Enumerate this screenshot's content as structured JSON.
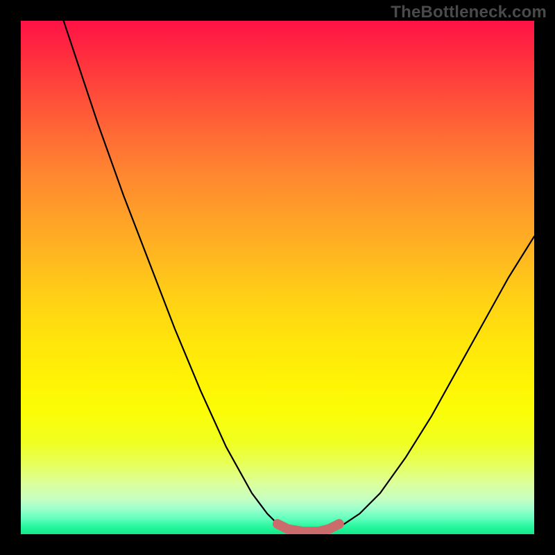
{
  "watermark": "TheBottleneck.com",
  "chart_data": {
    "type": "line",
    "title": "",
    "xlabel": "",
    "ylabel": "",
    "xlim": [
      0,
      100
    ],
    "ylim": [
      0,
      100
    ],
    "series": [
      {
        "name": "bottleneck-curve",
        "x": [
          0,
          5,
          10,
          15,
          20,
          25,
          30,
          35,
          40,
          45,
          48,
          50,
          52,
          55,
          58,
          60,
          63,
          66,
          70,
          75,
          80,
          85,
          90,
          95,
          100
        ],
        "values": [
          125,
          110,
          95,
          80,
          66,
          53,
          40,
          28,
          17,
          8,
          4,
          2,
          1,
          0.5,
          0.5,
          1,
          2,
          4,
          8,
          15,
          23,
          32,
          41,
          50,
          58
        ]
      },
      {
        "name": "optimal-zone",
        "x": [
          50,
          52,
          55,
          58,
          60,
          62
        ],
        "values": [
          2,
          1,
          0.5,
          0.5,
          1,
          2
        ]
      }
    ],
    "colors": {
      "curve": "#000000",
      "optimal_zone": "#cc6b6b",
      "gradient_top": "#ff1246",
      "gradient_mid": "#ffe40c",
      "gradient_bottom": "#12e88a"
    }
  }
}
